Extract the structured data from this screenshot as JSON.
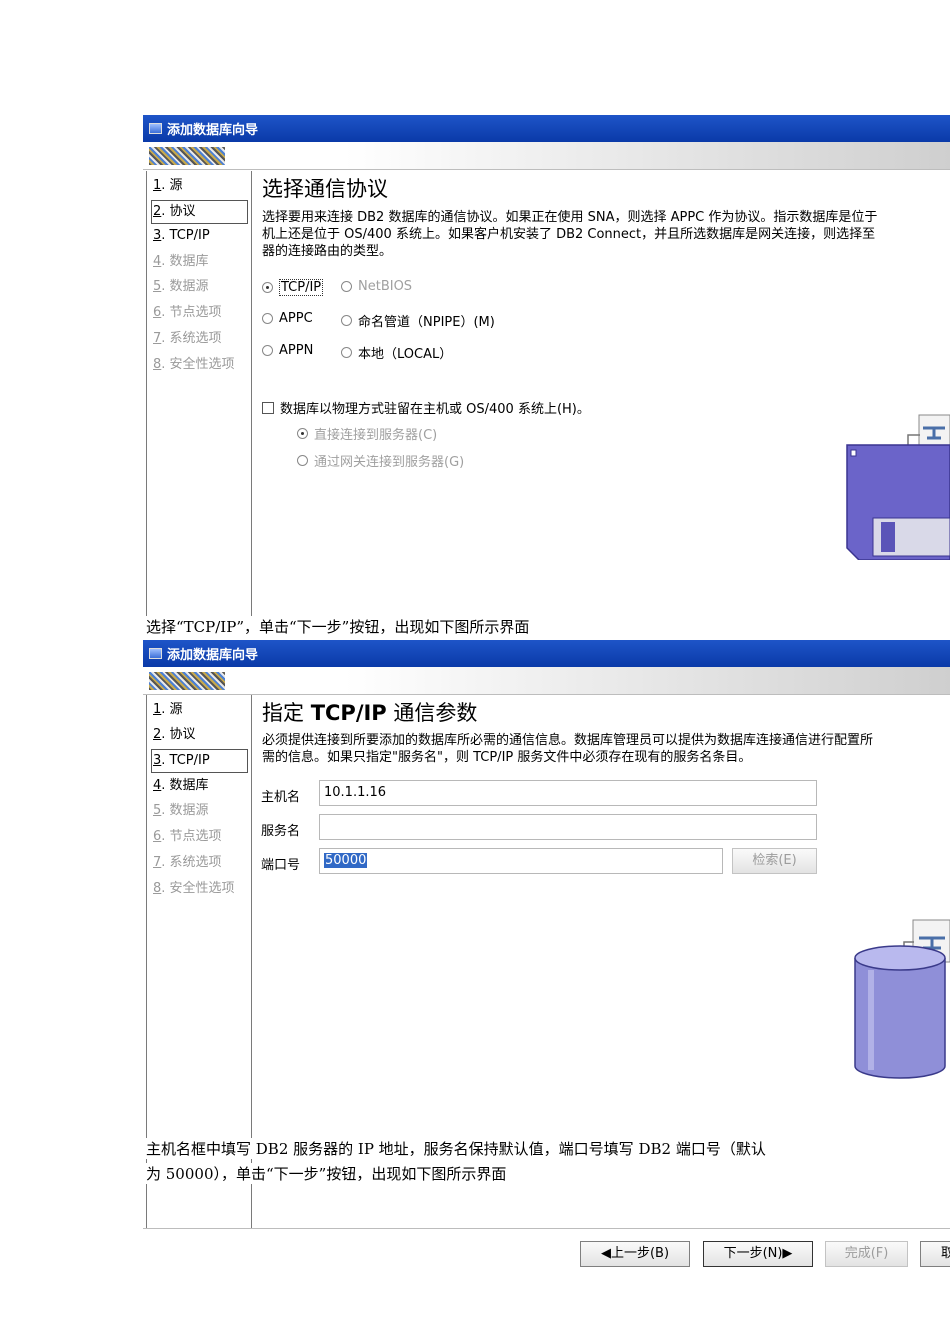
{
  "window_title": "添加数据库向导",
  "steps": [
    {
      "num": "1",
      "label": ". 源"
    },
    {
      "num": "2",
      "label": ". 协议"
    },
    {
      "num": "3",
      "label": ". TCP/IP"
    },
    {
      "num": "4",
      "label": ". 数据库"
    },
    {
      "num": "5",
      "label": ". 数据源"
    },
    {
      "num": "6",
      "label": ". 节点选项"
    },
    {
      "num": "7",
      "label": ". 系统选项"
    },
    {
      "num": "8",
      "label": ". 安全性选项"
    }
  ],
  "page1": {
    "heading": "选择通信协议",
    "desc1": "选择要用来连接 DB2 数据库的通信协议。如果正在使用 SNA，则选择 APPC 作为协议。指示数据库是位于",
    "desc2": "机上还是位于 OS/400 系统上。如果客户机安装了 DB2 Connect，并且所选数据库是网关连接，则选择至",
    "desc3": "器的连接路由的类型。",
    "tcpip": "TCP/IP",
    "netbios": "NetBIOS",
    "appc": "APPC",
    "named_pipe": "命名管道（NPIPE）(M)",
    "appn": "APPN",
    "local": "本地（LOCAL）",
    "host_check": "数据库以物理方式驻留在主机或 OS/400 系统上(H)。",
    "direct": "直接连接到服务器(C)",
    "gateway": "通过网关连接到服务器(G)"
  },
  "caption1": "选择“TCP/IP”，单击“下一步”按钮，出现如下图所示界面",
  "page2": {
    "heading_pre": "指定 ",
    "heading_bold": "TCP/IP",
    "heading_post": " 通信参数",
    "desc1": "必须提供连接到所要添加的数据库所必需的通信信息。数据库管理员可以提供为数据库连接通信进行配置所",
    "desc2": "需的信息。如果只指定\"服务名\"，则 TCP/IP 服务文件中必须存在现有的服务名条目。",
    "host_label": "主机名",
    "host_value": "10.1.1.16",
    "service_label": "服务名",
    "service_value": "",
    "port_label": "端口号",
    "port_value": "50000",
    "search_button": "检索(E)"
  },
  "caption2_line1": "主机名框中填写 DB2 服务器的 IP 地址，服务名保持默认值，端口号填写 DB2 端口号（默认",
  "caption2_line2": "为 50000），单击“下一步”按钮，出现如下图所示界面",
  "footer": {
    "back": "◀上一步(B)",
    "next": "下一步(N)▶",
    "finish": "完成(F)",
    "cancel": "取"
  }
}
